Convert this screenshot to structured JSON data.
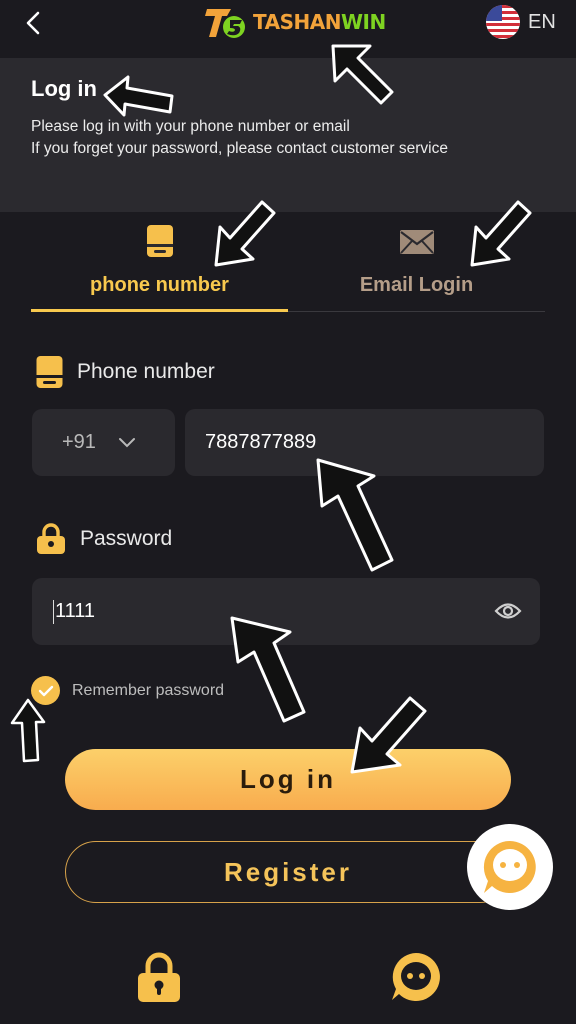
{
  "header": {
    "back_icon": "chevron-left-icon",
    "brand_part1": "TASHAN",
    "brand_part2": "WIN",
    "language": "EN",
    "flag_icon": "us-flag-icon"
  },
  "intro": {
    "title": "Log in",
    "line1": "Please log in with your phone number or email",
    "line2": "If you forget your password, please contact customer service"
  },
  "tabs": [
    {
      "label": "phone number",
      "icon": "phone-icon",
      "active": true
    },
    {
      "label": "Email Login",
      "icon": "mail-icon",
      "active": false
    }
  ],
  "phone": {
    "label": "Phone number",
    "country_code": "+91",
    "value": "7887877889"
  },
  "password": {
    "label": "Password",
    "value": "1111"
  },
  "remember": {
    "label": "Remember password",
    "checked": true
  },
  "buttons": {
    "login": "Log in",
    "register": "Register"
  },
  "bottom_nav": [
    {
      "icon": "lock-icon"
    },
    {
      "icon": "customer-service-icon"
    }
  ],
  "colors": {
    "background": "#1b1a1f",
    "panel": "#2b2a2f",
    "accent": "#f8c94e",
    "login_gradient_top": "#fcd06a",
    "login_gradient_bottom": "#f8ac4e"
  }
}
